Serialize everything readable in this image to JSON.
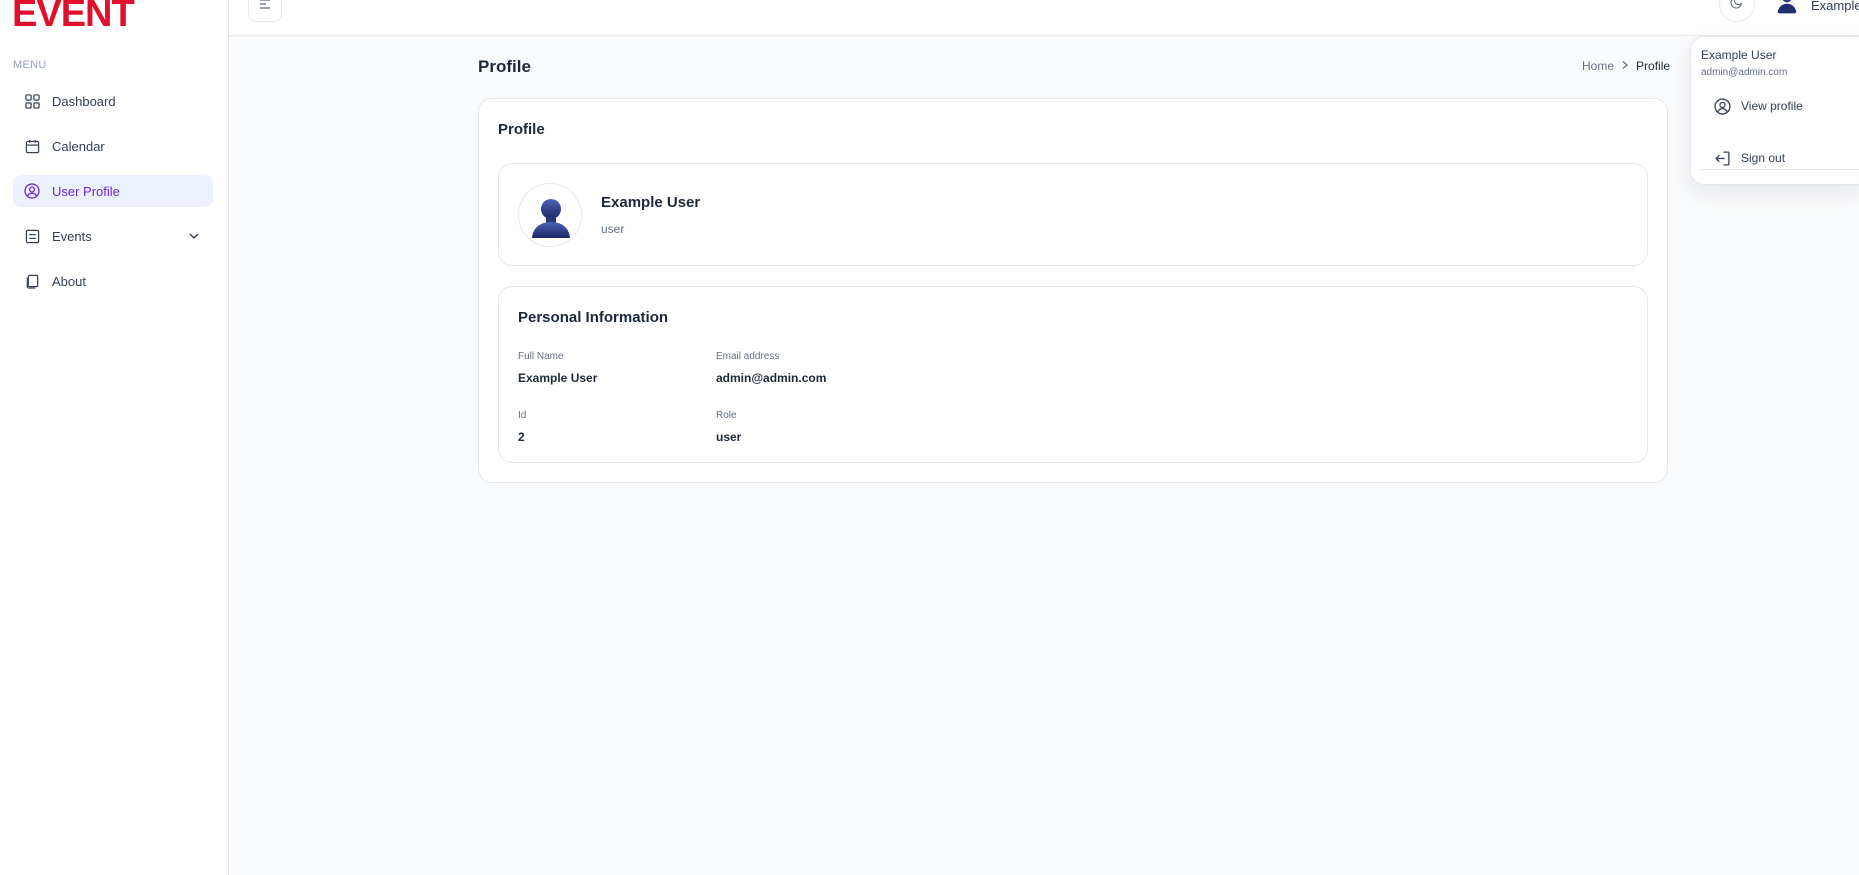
{
  "brand": {
    "logo_text": "EVENT",
    "color": "#e0102d"
  },
  "sidebar": {
    "menu_label": "MENU",
    "items": [
      {
        "label": "Dashboard",
        "icon": "grid-icon"
      },
      {
        "label": "Calendar",
        "icon": "calendar-icon"
      },
      {
        "label": "User Profile",
        "icon": "user-circle-icon",
        "active": true
      },
      {
        "label": "Events",
        "icon": "list-icon",
        "has_submenu": true
      },
      {
        "label": "About",
        "icon": "pages-icon"
      }
    ]
  },
  "header": {
    "user_name": "Example User"
  },
  "page": {
    "title": "Profile",
    "breadcrumb": {
      "home": "Home",
      "current": "Profile"
    }
  },
  "profile_card": {
    "title": "Profile",
    "name": "Example User",
    "role": "user"
  },
  "personal_info": {
    "title": "Personal Information",
    "full_name_label": "Full Name",
    "full_name": "Example User",
    "email_label": "Email address",
    "email": "admin@admin.com",
    "id_label": "Id",
    "id": "2",
    "role_label": "Role",
    "role": "user"
  },
  "dropdown": {
    "name": "Example User",
    "email": "admin@admin.com",
    "view_profile": "View profile",
    "sign_out": "Sign out"
  },
  "colors": {
    "accent": "#6d28d9",
    "active_bg": "#ecf0ff"
  }
}
